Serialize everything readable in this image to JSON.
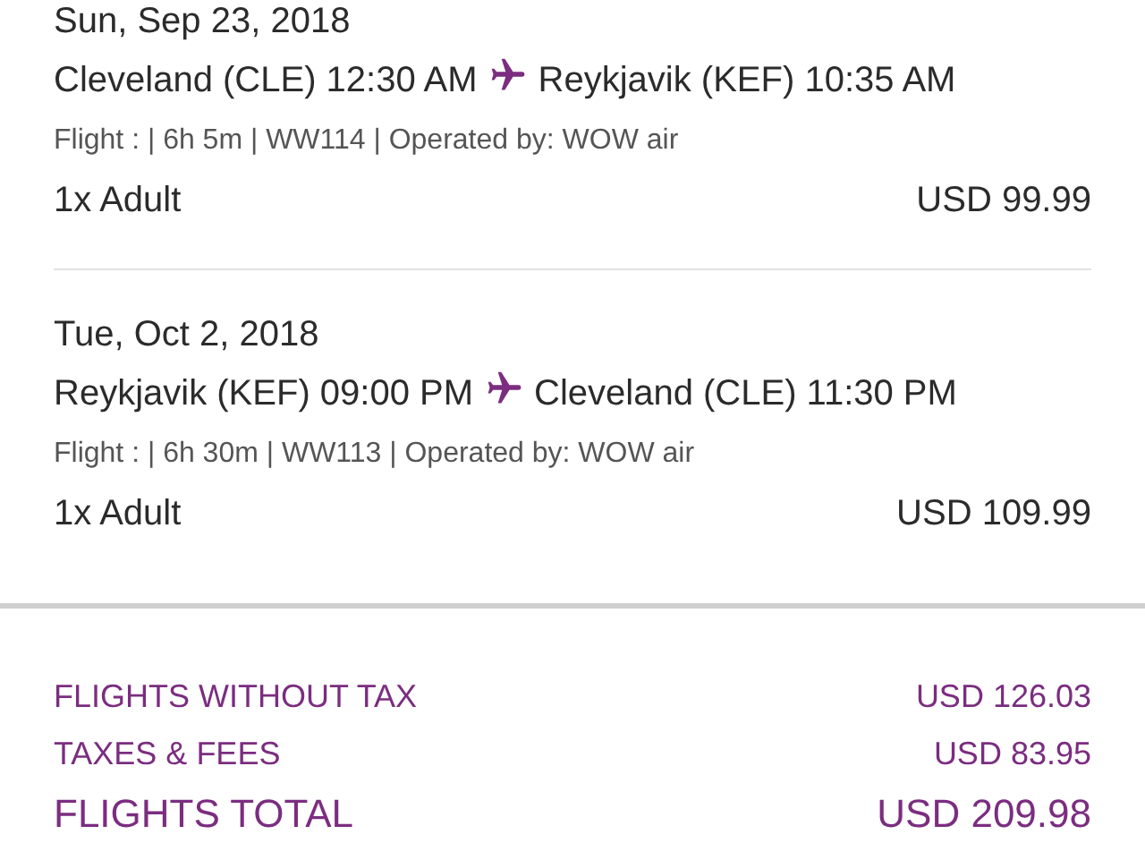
{
  "flights": [
    {
      "date": "Sun, Sep 23, 2018",
      "origin": "Cleveland (CLE) 12:30 AM",
      "destination": "Reykjavik (KEF) 10:35 AM",
      "details": "Flight : | 6h 5m | WW114 | Operated by: WOW air",
      "passengers": "1x Adult",
      "price": "USD 99.99"
    },
    {
      "date": "Tue, Oct 2, 2018",
      "origin": "Reykjavik (KEF) 09:00 PM",
      "destination": "Cleveland (CLE) 11:30 PM",
      "details": "Flight : | 6h 30m | WW113 | Operated by: WOW air",
      "passengers": "1x Adult",
      "price": "USD 109.99"
    }
  ],
  "summary": [
    {
      "kind": "line",
      "label": "FLIGHTS WITHOUT TAX",
      "amount": "USD 126.03"
    },
    {
      "kind": "line",
      "label": "TAXES & FEES",
      "amount": "USD 83.95"
    },
    {
      "kind": "total",
      "label": "FLIGHTS TOTAL",
      "amount": "USD 209.98"
    }
  ]
}
